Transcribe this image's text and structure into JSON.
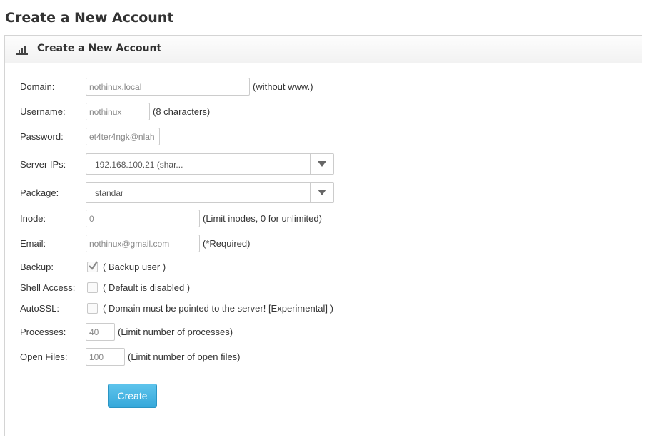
{
  "page": {
    "title": "Create a New Account"
  },
  "panel": {
    "title": "Create a New Account",
    "icon": "bar-chart-icon"
  },
  "form": {
    "domain": {
      "label": "Domain:",
      "value": "nothinux.local",
      "hint": "(without www.)"
    },
    "username": {
      "label": "Username:",
      "value": "nothinux",
      "hint": "(8 characters)"
    },
    "password": {
      "label": "Password:",
      "value": "et4ter4ngk@nlah"
    },
    "server_ips": {
      "label": "Server IPs:",
      "selected": "192.168.100.21 (shar..."
    },
    "package": {
      "label": "Package:",
      "selected": "standar"
    },
    "inode": {
      "label": "Inode:",
      "value": "0",
      "hint": "(Limit inodes, 0 for unlimited)"
    },
    "email": {
      "label": "Email:",
      "value": "nothinux@gmail.com",
      "hint": "(*Required)"
    },
    "backup": {
      "label": "Backup:",
      "checked": true,
      "hint": "( Backup user )"
    },
    "shell_access": {
      "label": "Shell Access:",
      "checked": false,
      "hint": "( Default is disabled )"
    },
    "autossl": {
      "label": "AutoSSL:",
      "checked": false,
      "hint": "( Domain must be pointed to the server! [Experimental] )"
    },
    "processes": {
      "label": "Processes:",
      "value": "40",
      "hint": "(Limit number of processes)"
    },
    "open_files": {
      "label": "Open Files:",
      "value": "100",
      "hint": "(Limit number of open files)"
    }
  },
  "actions": {
    "create_label": "Create"
  },
  "colors": {
    "button": "#36a8da",
    "border": "#d4d4d4"
  }
}
